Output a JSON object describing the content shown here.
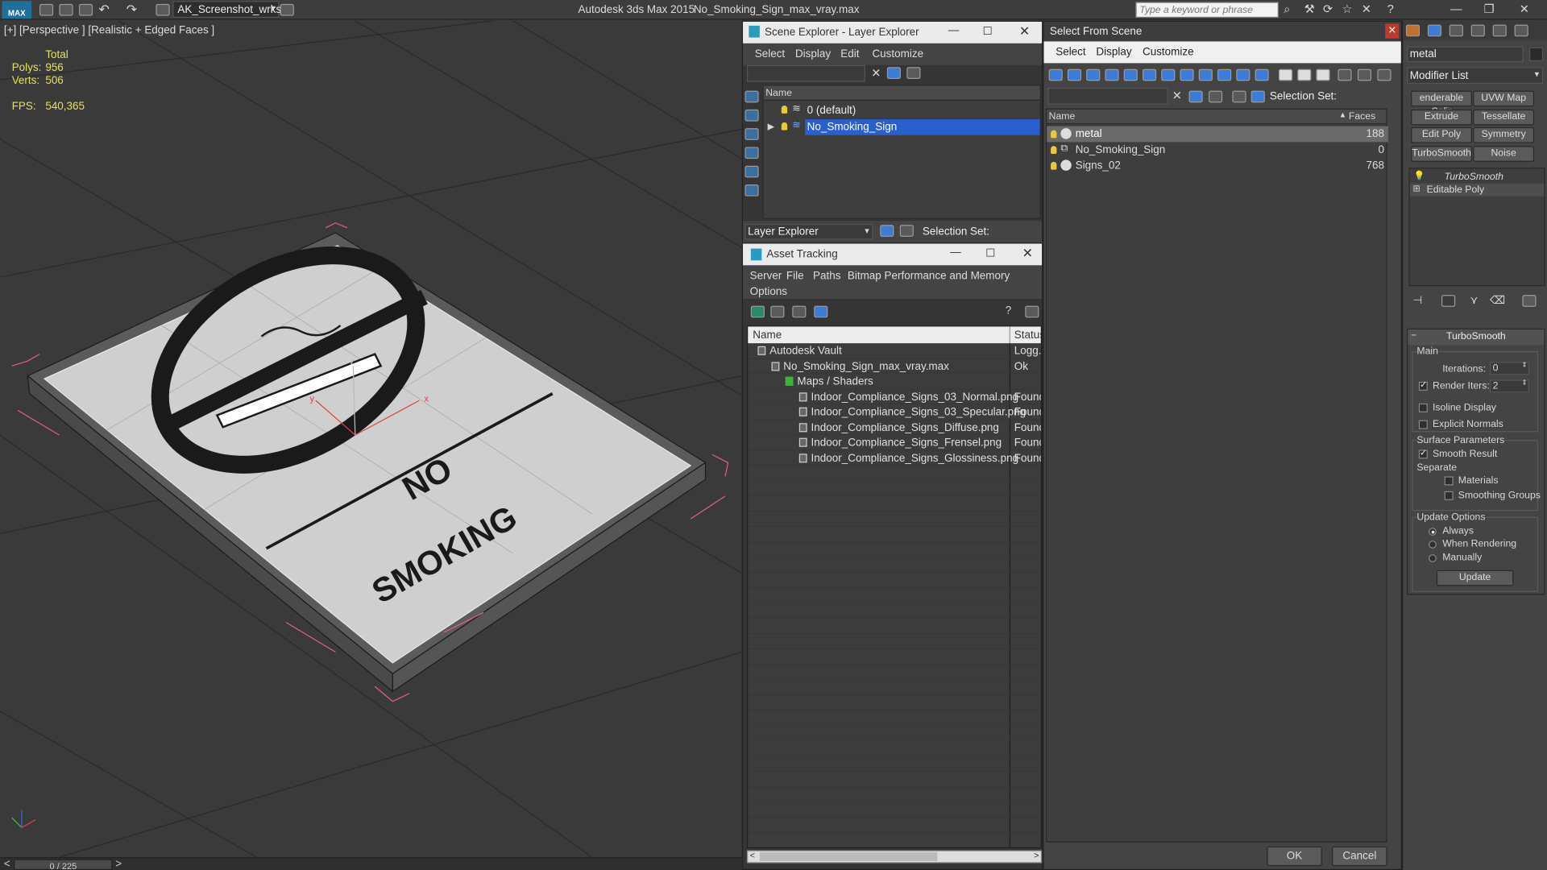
{
  "app": {
    "title": "Autodesk 3ds Max  2015",
    "file": "No_Smoking_Sign_max_vray.max",
    "workspace": "AK_Screenshot_wrksp",
    "search_placeholder": "Type a keyword or phrase"
  },
  "viewport": {
    "label": "[+] [Perspective ] [Realistic + Edged Faces ]",
    "stats_header": "Total",
    "polys_label": "Polys:",
    "polys": "956",
    "verts_label": "Verts:",
    "verts": "506",
    "fps_label": "FPS:",
    "fps": "540,365",
    "sign_line1": "NO",
    "sign_line2": "SMOKING",
    "axis_x": "x",
    "axis_y": "y",
    "axis_z": "z",
    "timeline": "0 / 225",
    "prev": "<",
    "next": ">"
  },
  "scene_explorer": {
    "title": "Scene Explorer - Layer Explorer",
    "menu": [
      "Select",
      "Display",
      "Edit",
      "Customize"
    ],
    "col_name": "Name",
    "layers": [
      {
        "name": "0 (default)"
      },
      {
        "name": "No_Smoking_Sign"
      }
    ],
    "footer_mode": "Layer Explorer",
    "footer_selset": "Selection Set:"
  },
  "asset_tracking": {
    "title": "Asset Tracking",
    "menu": [
      "Server",
      "File",
      "Paths",
      "Bitmap Performance and Memory",
      "Options"
    ],
    "col_name": "Name",
    "col_status": "Status",
    "rows": [
      {
        "name": "Autodesk Vault",
        "status": "Logg..."
      },
      {
        "name": "No_Smoking_Sign_max_vray.max",
        "status": "Ok"
      },
      {
        "name": "Maps / Shaders",
        "status": ""
      },
      {
        "name": "Indoor_Compliance_Signs_03_Normal.png",
        "status": "Found"
      },
      {
        "name": "Indoor_Compliance_Signs_03_Specular.png",
        "status": "Found"
      },
      {
        "name": "Indoor_Compliance_Signs_Diffuse.png",
        "status": "Found"
      },
      {
        "name": "Indoor_Compliance_Signs_Frensel.png",
        "status": "Found"
      },
      {
        "name": "Indoor_Compliance_Signs_Glossiness.png",
        "status": "Found"
      }
    ]
  },
  "select_from_scene": {
    "title": "Select From Scene",
    "menu": [
      "Select",
      "Display",
      "Customize"
    ],
    "selset": "Selection Set:",
    "col_name": "Name",
    "col_faces": "Faces",
    "rows": [
      {
        "name": "metal",
        "faces": "188"
      },
      {
        "name": "No_Smoking_Sign",
        "faces": "0"
      },
      {
        "name": "Signs_02",
        "faces": "768"
      }
    ],
    "ok": "OK",
    "cancel": "Cancel"
  },
  "command_panel": {
    "object_name": "metal",
    "modifier_list": "Modifier List",
    "buttons": [
      "enderable Splir",
      "UVW Map",
      "Extrude",
      "Tessellate",
      "Edit Poly",
      "Symmetry",
      "TurboSmooth",
      "Noise"
    ],
    "stack": [
      "TurboSmooth",
      "Editable Poly"
    ],
    "rollout_title": "TurboSmooth",
    "main": "Main",
    "iterations_label": "Iterations:",
    "iterations": "0",
    "render_iters_label": "Render Iters:",
    "render_iters": "2",
    "isoline": "Isoline Display",
    "explicit": "Explicit Normals",
    "surface": "Surface Parameters",
    "smooth_result": "Smooth Result",
    "separate": "Separate",
    "materials": "Materials",
    "smoothing_groups": "Smoothing Groups",
    "update_options": "Update Options",
    "always": "Always",
    "when_rendering": "When Rendering",
    "manually": "Manually",
    "update": "Update"
  },
  "colors": {
    "selection": "#2a5fd0",
    "accent": "#3d7bd8",
    "found": "#d8d8d8"
  }
}
